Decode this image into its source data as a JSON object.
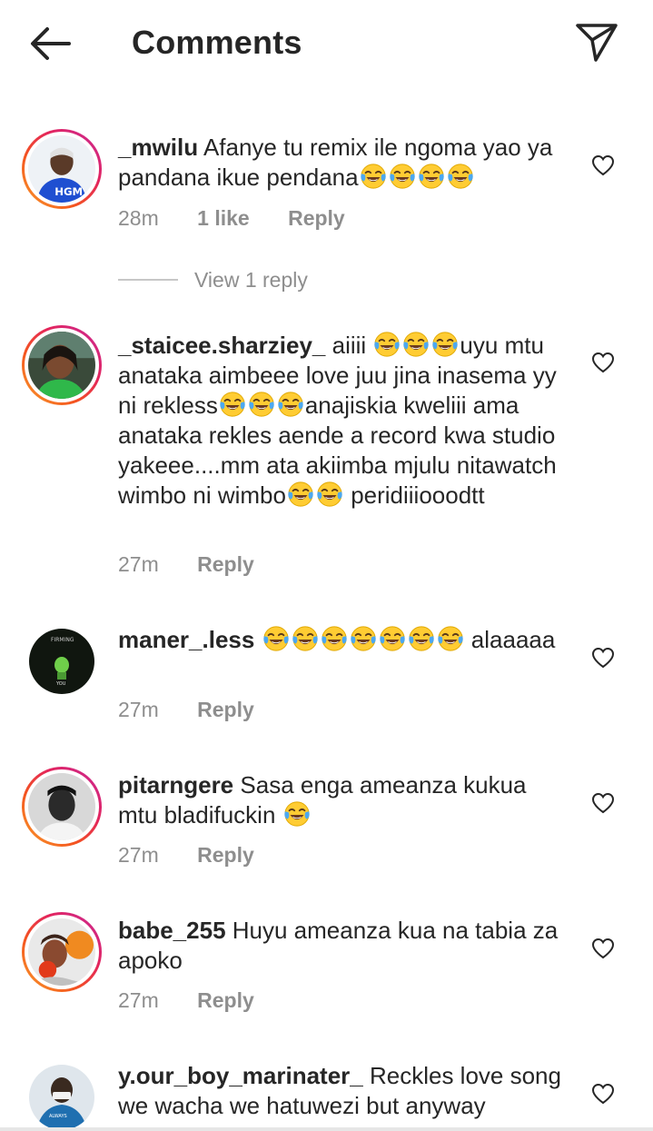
{
  "header": {
    "title": "Comments",
    "back_icon": "arrow-left-icon",
    "send_icon": "paper-plane-icon"
  },
  "colors": {
    "text": "#262626",
    "muted": "#8e8e8e",
    "emoji_face": "#FFCC33",
    "emoji_tears": "#4CA8F0",
    "story_ring": "#e3245d"
  },
  "comments": [
    {
      "username": "_mwilu",
      "text_before": "Afanye tu remix ile ngoma yao ya pandana ikue pendana",
      "emoji_count": 4,
      "time": "28m",
      "likes": "1 like",
      "reply": "Reply",
      "view_replies": "View 1 reply"
    },
    {
      "username": "_staicee.sharziey_",
      "text_a": "aiiii ",
      "text_b": "uyu mtu anataka aimbeee love juu jina inasema yy ni rekless",
      "text_c": "anajiskia kweliii ama anataka rekles aende a record kwa studio yakeee....mm ata akiimba mjulu nitawatch wimbo ni wimbo",
      "text_d": "peridiiiooodtt",
      "time": "27m",
      "reply": "Reply"
    },
    {
      "username": "maner_.less",
      "text_after": "alaaaaa",
      "time": "27m",
      "reply": "Reply"
    },
    {
      "username": "pitarngere",
      "text": "Sasa enga ameanza kukua mtu bladifuckin",
      "time": "27m",
      "reply": "Reply"
    },
    {
      "username": "babe_255",
      "text": "Huyu ameanza kua na tabia za apoko",
      "time": "27m",
      "reply": "Reply"
    },
    {
      "username": "y.our_boy_marinater_",
      "text": "Reckles love song we wacha we hatuwezi but anyway"
    }
  ]
}
